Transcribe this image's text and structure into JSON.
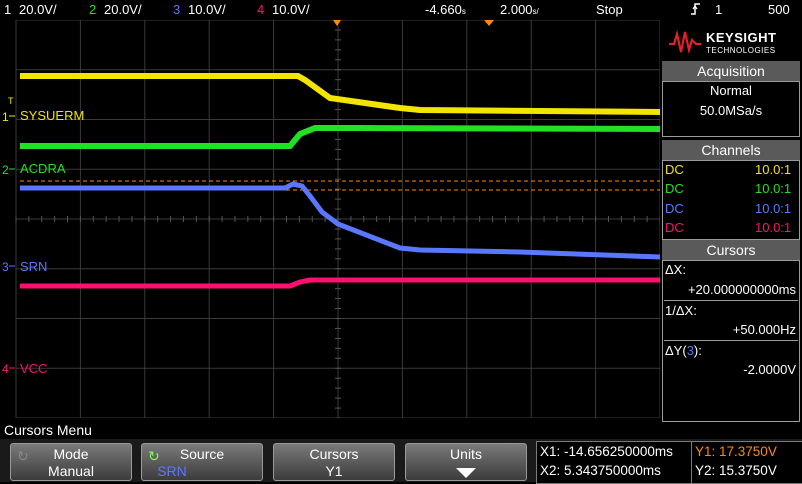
{
  "colors": {
    "ch1": "#f2e600",
    "ch2": "#22e022",
    "ch3": "#5a78ff",
    "ch4": "#ff1070",
    "trigger": "#ff8a00",
    "grid": "#3a3a3a"
  },
  "topbar": {
    "ch1_num": "1",
    "ch1_scale": "20.0V/",
    "ch2_num": "2",
    "ch2_scale": "20.0V/",
    "ch3_num": "3",
    "ch3_scale": "10.0V/",
    "ch4_num": "4",
    "ch4_scale": "10.0V/",
    "time_delay": "-4.660",
    "time_delay_unit": "s",
    "time_scale": "2.000",
    "time_scale_unit": "s/",
    "run_state": "Stop",
    "trigger_icon": "trigger-edge-icon",
    "trigger_source": "1",
    "trigger_level": "500"
  },
  "channels_labels": {
    "ch1_name": "SYSUERM",
    "ch2_name": "ACDRA",
    "ch3_name": "SRN",
    "ch4_name": "VCC"
  },
  "panel": {
    "brand_line1": "KEYSIGHT",
    "brand_line2": "TECHNOLOGIES",
    "acquisition_title": "Acquisition",
    "acquisition_mode": "Normal",
    "sample_rate": "50.0MSa/s",
    "channels_title": "Channels",
    "channels": [
      {
        "coupling": "DC",
        "probe": "10.0:1"
      },
      {
        "coupling": "DC",
        "probe": "10.0:1"
      },
      {
        "coupling": "DC",
        "probe": "10.0:1"
      },
      {
        "coupling": "DC",
        "probe": "10.0:1"
      }
    ],
    "cursors_title": "Cursors",
    "delta_x_label": "ΔX:",
    "delta_x_value": "+20.000000000ms",
    "inv_delta_x_label": "1/ΔX:",
    "inv_delta_x_value": "+50.000Hz",
    "delta_y_label_pre": "ΔY(",
    "delta_y_channel": "3",
    "delta_y_label_post": "):",
    "delta_y_value": "-2.0000V"
  },
  "menu": {
    "title": "Cursors Menu",
    "keys": [
      {
        "label": "Mode",
        "value": "Manual"
      },
      {
        "label": "Source",
        "value": "SRN"
      },
      {
        "label": "Cursors",
        "value": "Y1"
      },
      {
        "label": "Units",
        "value": ""
      }
    ]
  },
  "readout": {
    "x1": "X1: -14.656250000ms",
    "x2": "X2: 5.343750000ms",
    "y1": "Y1: 17.3750V",
    "y2": "Y2: 15.3750V"
  }
}
